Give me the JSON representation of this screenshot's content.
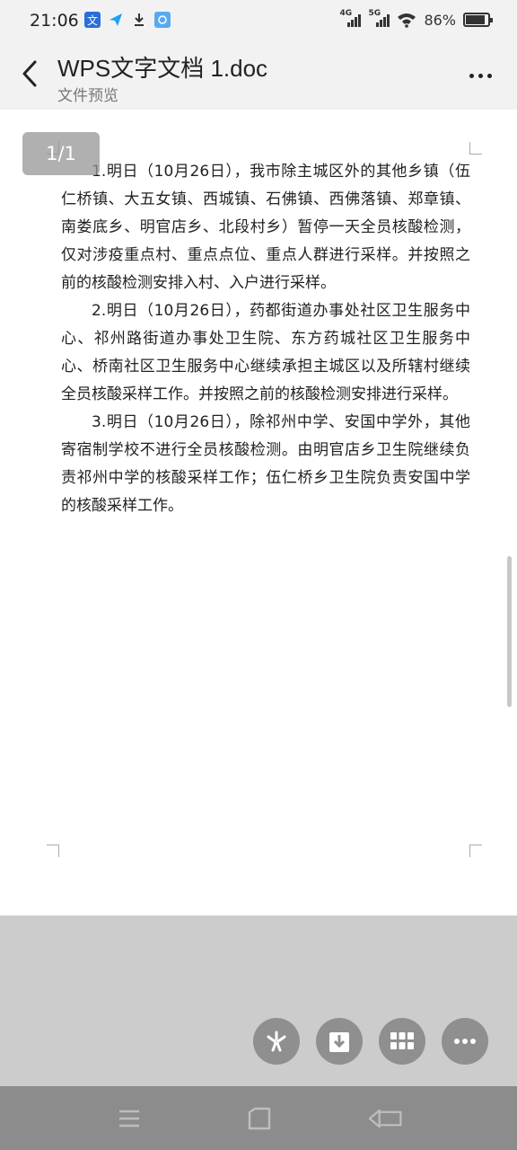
{
  "status_bar": {
    "time": "21:06",
    "battery": "86%",
    "sim1_label": "4G",
    "sim2_label": "5G",
    "left_icons": [
      "translate-icon",
      "send-icon",
      "download-icon",
      "app-icon"
    ]
  },
  "header": {
    "title": "WPS文字文档 1.doc",
    "subtitle": "文件预览"
  },
  "document": {
    "page_indicator": "1/1",
    "paragraphs": [
      "1.明日（10月26日），我市除主城区外的其他乡镇（伍仁桥镇、大五女镇、西城镇、石佛镇、西佛落镇、郑章镇、南娄底乡、明官店乡、北段村乡）暂停一天全员核酸检测，仅对涉疫重点村、重点点位、重点人群进行采样。并按照之前的核酸检测安排入村、入户进行采样。",
      "2.明日（10月26日），药都街道办事处社区卫生服务中心、祁州路街道办事处卫生院、东方药城社区卫生服务中心、桥南社区卫生服务中心继续承担主城区以及所辖村继续全员核酸采样工作。并按照之前的核酸检测安排进行采样。",
      "3.明日（10月26日），除祁州中学、安国中学外，其他寄宿制学校不进行全员核酸检测。由明官店乡卫生院继续负责祁州中学的核酸采样工作；伍仁桥乡卫生院负责安国中学的核酸采样工作。"
    ]
  },
  "actions": {
    "buttons": [
      "wps-icon",
      "save-to-device-icon",
      "apps-grid-icon",
      "more-icon"
    ]
  },
  "colors": {
    "background": "#f2f2f2",
    "page": "#ffffff",
    "lower_area": "#cccccc",
    "fab": "#8f8f8f",
    "navbar": "#8c8c8c"
  }
}
